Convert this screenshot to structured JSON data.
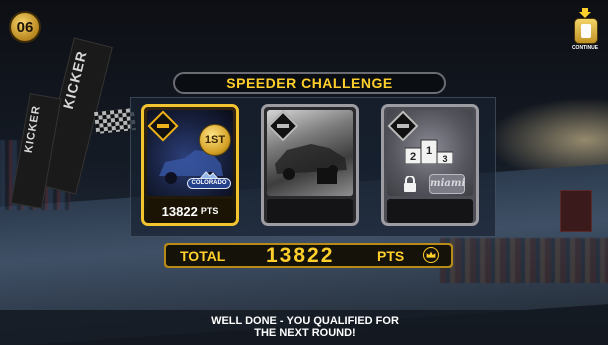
{
  "round": {
    "number": "06"
  },
  "continue": {
    "label": "CONTINUE"
  },
  "scene": {
    "banner_text": "KICKER"
  },
  "challenge": {
    "title": "SPEEDER CHALLENGE"
  },
  "cards": [
    {
      "state": "completed",
      "medal": "1ST",
      "event_logo_text": "COLORADO",
      "points": "13822",
      "points_unit": "PTS"
    },
    {
      "state": "preview",
      "points": "",
      "points_unit": ""
    },
    {
      "state": "locked",
      "event_logo_text": "miami",
      "podium": [
        "2",
        "1",
        "3"
      ]
    }
  ],
  "total": {
    "label": "TOTAL",
    "value": "13822",
    "unit": "PTS"
  },
  "message": {
    "line1": "WELL DONE - YOU QUALIFIED FOR",
    "line2": "THE NEXT ROUND!"
  },
  "colors": {
    "accent_gold": "#ffcf2c",
    "card_border_active": "#f2c430",
    "card_border_inactive": "#9c9ca2"
  },
  "icons": [
    "round-badge-icon",
    "continue-arrow-icon",
    "controller-button-icon",
    "event-diamond-icon",
    "medal-icon",
    "podium-icon",
    "lock-icon",
    "crown-icon"
  ]
}
